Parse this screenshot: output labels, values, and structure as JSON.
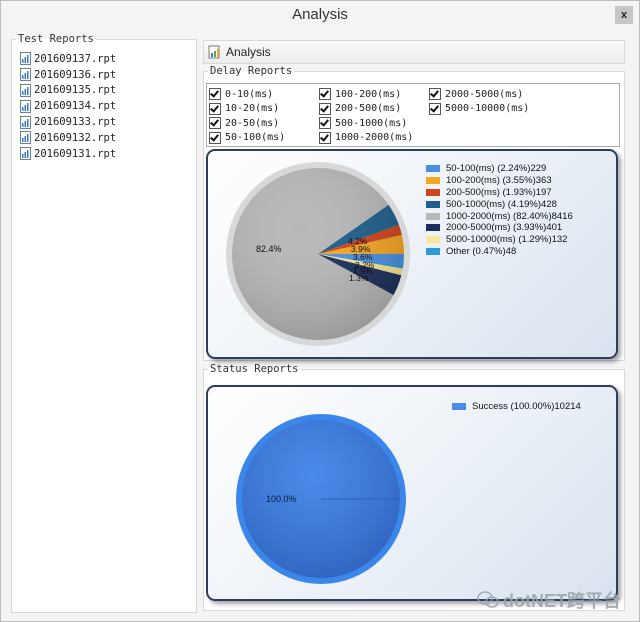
{
  "window": {
    "title": "Analysis",
    "close_label": "x"
  },
  "test_reports": {
    "legend": "Test Reports",
    "files": [
      "201609137.rpt",
      "201609136.rpt",
      "201609135.rpt",
      "201609134.rpt",
      "201609133.rpt",
      "201609132.rpt",
      "201609131.rpt"
    ]
  },
  "tab": {
    "label": "Analysis"
  },
  "delay_reports": {
    "legend": "Delay  Reports",
    "checkboxes": [
      {
        "label": "0-10(ms)",
        "checked": true
      },
      {
        "label": "10-20(ms)",
        "checked": true
      },
      {
        "label": "20-50(ms)",
        "checked": true
      },
      {
        "label": "50-100(ms)",
        "checked": true
      },
      {
        "label": "100-200(ms)",
        "checked": true
      },
      {
        "label": "200-500(ms)",
        "checked": true
      },
      {
        "label": "500-1000(ms)",
        "checked": true
      },
      {
        "label": "1000-2000(ms)",
        "checked": true
      },
      {
        "label": "2000-5000(ms)",
        "checked": true
      },
      {
        "label": "5000-10000(ms)",
        "checked": true
      }
    ]
  },
  "status_reports": {
    "legend": "Status Reports"
  },
  "watermark": "dotNET跨平台",
  "chart_data": [
    {
      "type": "pie",
      "legend_entries": [
        {
          "label": "50-100(ms) (2.24%)229",
          "value": 229,
          "percent": 2.24,
          "color": "#4a90e2"
        },
        {
          "label": "100-200(ms) (3.55%)363",
          "value": 363,
          "percent": 3.55,
          "color": "#f5a623"
        },
        {
          "label": "200-500(ms) (1.93%)197",
          "value": 197,
          "percent": 1.93,
          "color": "#d0451b"
        },
        {
          "label": "500-1000(ms) (4.19%)428",
          "value": 428,
          "percent": 4.19,
          "color": "#1f5f8b"
        },
        {
          "label": "1000-2000(ms) (82.40%)8416",
          "value": 8416,
          "percent": 82.4,
          "color": "#b8b8b8"
        },
        {
          "label": "2000-5000(ms) (3.93%)401",
          "value": 401,
          "percent": 3.93,
          "color": "#1c2f5c"
        },
        {
          "label": "5000-10000(ms) (1.29%)132",
          "value": 132,
          "percent": 1.29,
          "color": "#fbe79a"
        },
        {
          "label": "Other (0.47%)48",
          "value": 48,
          "percent": 0.47,
          "color": "#2f9ad8"
        }
      ],
      "slice_labels": [
        "82.4%",
        "4.2%",
        "3.9%",
        "3.6%",
        "2.2%",
        "1.9%",
        "1.3%"
      ],
      "legend_placement": "right"
    },
    {
      "type": "pie",
      "legend_entries": [
        {
          "label": "Success (100.00%)10214",
          "value": 10214,
          "percent": 100.0,
          "color": "#4a8ae8"
        }
      ],
      "slice_labels": [
        "100.0%"
      ],
      "legend_placement": "top-right"
    }
  ]
}
